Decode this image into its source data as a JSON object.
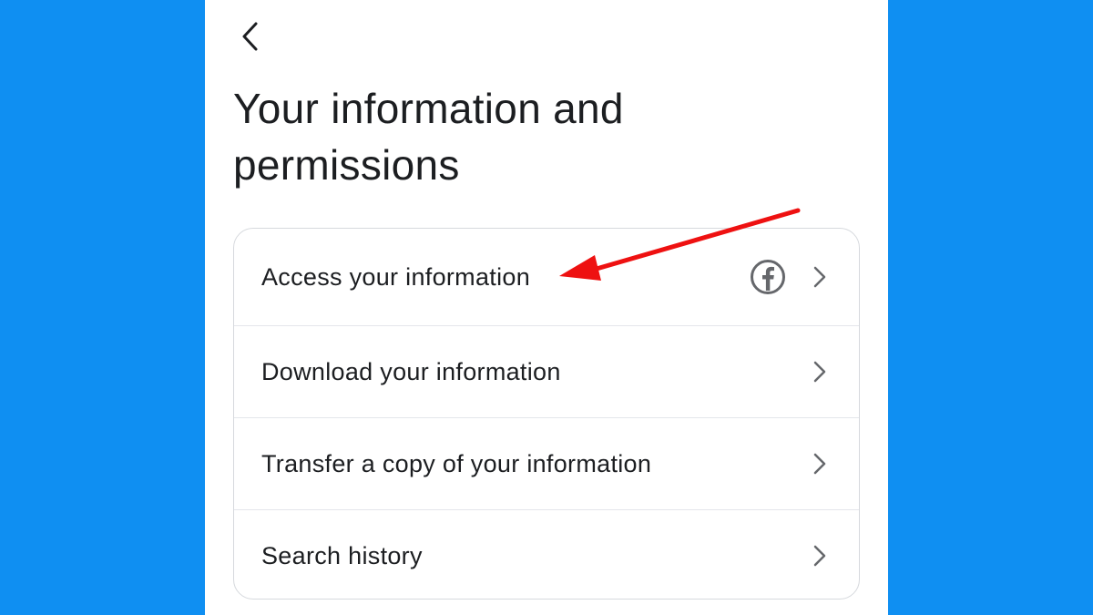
{
  "header": {
    "back_icon": "chevron-left-icon",
    "title": "Your information and permissions"
  },
  "menu": {
    "items": [
      {
        "label": "Access your information",
        "badge_icon": "facebook-icon",
        "chevron_icon": "chevron-right-icon"
      },
      {
        "label": "Download your information",
        "chevron_icon": "chevron-right-icon"
      },
      {
        "label": "Transfer a copy of your information",
        "chevron_icon": "chevron-right-icon"
      },
      {
        "label": "Search history",
        "chevron_icon": "chevron-right-icon"
      }
    ]
  },
  "annotation": {
    "type": "red-arrow",
    "target": "Access your information",
    "color": "#ee1111"
  },
  "colors": {
    "background": "#0f8ff2",
    "panel": "#ffffff",
    "text": "#1c1e21",
    "icon": "#65676b",
    "border": "#d6d9dd"
  }
}
